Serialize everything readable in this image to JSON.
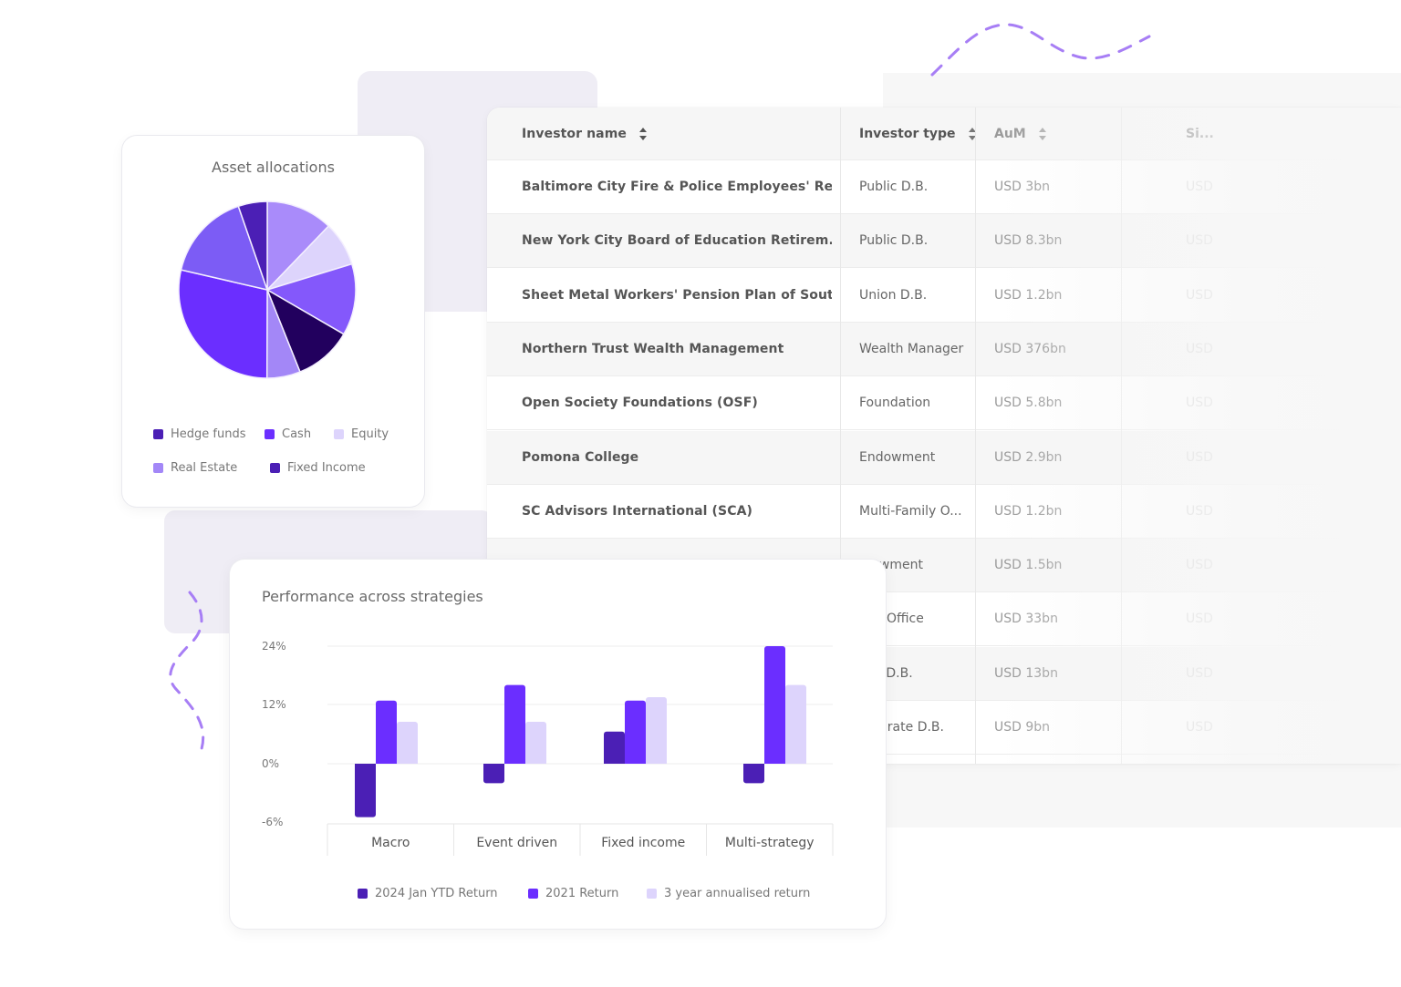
{
  "colors": {
    "hedge_dark": "#4b1fb5",
    "bright": "#6b2eff",
    "lavender": "#ddd4fc",
    "mid_purple": "#8458fb",
    "light_purple": "#a98bfa",
    "navy": "#22005e",
    "soft_purple": "#7c5cf5",
    "squiggle": "#a77ef5"
  },
  "table": {
    "columns": [
      {
        "label": "Investor name",
        "sort_icon": "sort-icon"
      },
      {
        "label": "Investor type",
        "sort_icon": "sort-icon"
      },
      {
        "label": "AuM",
        "sort_icon": "sort-icon"
      },
      {
        "label": "Si..."
      }
    ],
    "rows": [
      {
        "name": "Baltimore City Fire & Police Employees' Re...",
        "type": "Public D.B.",
        "aum": "USD 3bn",
        "size": "USD"
      },
      {
        "name": "New York City Board of Education Retirem...",
        "type": "Public D.B.",
        "aum": "USD 8.3bn",
        "size": "USD"
      },
      {
        "name": "Sheet Metal Workers' Pension Plan of Sout...",
        "type": "Union D.B.",
        "aum": "USD 1.2bn",
        "size": "USD"
      },
      {
        "name": "Northern Trust Wealth Management",
        "type": "Wealth Manager",
        "aum": "USD 376bn",
        "size": "USD"
      },
      {
        "name": "Open Society Foundations (OSF)",
        "type": "Foundation",
        "aum": "USD 5.8bn",
        "size": "USD"
      },
      {
        "name": "Pomona College",
        "type": "Endowment",
        "aum": "USD 2.9bn",
        "size": "USD"
      },
      {
        "name": "SC Advisors International (SCA)",
        "type": "Multi-Family O...",
        "aum": "USD 1.2bn",
        "size": "USD"
      },
      {
        "name": "",
        "type": "...owment",
        "aum": "USD 1.5bn",
        "size": "USD"
      },
      {
        "name": "",
        "type": "...ly Office",
        "aum": "USD 33bn",
        "size": "USD"
      },
      {
        "name": "",
        "type": "...ic D.B.",
        "aum": "USD 13bn",
        "size": "USD"
      },
      {
        "name": "",
        "type": "...porate D.B.",
        "aum": "USD 9bn",
        "size": "USD"
      }
    ]
  },
  "chart_data": [
    {
      "type": "pie",
      "title": "Asset allocations",
      "slices": [
        {
          "value": 12.2,
          "color": "#a98bfa"
        },
        {
          "value": 8.1,
          "color": "#ddd4fc"
        },
        {
          "value": 13.1,
          "color": "#8458fb"
        },
        {
          "value": 10.6,
          "color": "#22005e"
        },
        {
          "value": 6.1,
          "color": "#a387f7"
        },
        {
          "value": 28.6,
          "color": "#6b2eff"
        },
        {
          "value": 16.1,
          "color": "#7c5cf5"
        },
        {
          "value": 5.3,
          "color": "#4b1fb5"
        }
      ],
      "legend": [
        {
          "label": "Hedge funds",
          "color": "#4b1fb5"
        },
        {
          "label": "Cash",
          "color": "#6b2eff"
        },
        {
          "label": "Equity",
          "color": "#ddd4fc"
        },
        {
          "label": "Real Estate",
          "color": "#a387f7"
        },
        {
          "label": "Fixed Income",
          "color": "#4b1fb5"
        }
      ]
    },
    {
      "type": "bar",
      "title": "Performance across strategies",
      "categories": [
        "Macro",
        "Event driven",
        "Fixed income",
        "Multi-strategy"
      ],
      "series": [
        {
          "name": "2024 Jan YTD Return",
          "color": "#4b1fb5",
          "values": [
            -5.5,
            -2,
            6.5,
            -2
          ]
        },
        {
          "name": "2021 Return",
          "color": "#6b2eff",
          "values": [
            12.8,
            16,
            12.8,
            24
          ]
        },
        {
          "name": "3 year annualised return",
          "color": "#ddd4fc",
          "values": [
            8.5,
            8.5,
            13.5,
            16
          ]
        }
      ],
      "yticks": [
        {
          "value": 24,
          "label": "24%"
        },
        {
          "value": 12,
          "label": "12%"
        },
        {
          "value": 0,
          "label": "0%"
        },
        {
          "value": -6,
          "label": "-6%"
        }
      ],
      "ylim": [
        -6,
        24
      ],
      "grid": true,
      "legend_position": "bottom"
    }
  ]
}
